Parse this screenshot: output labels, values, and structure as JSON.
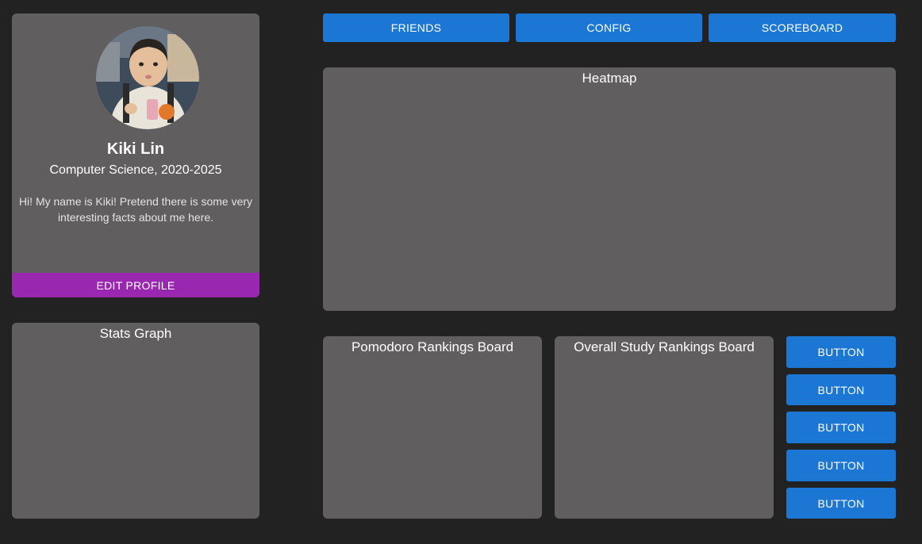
{
  "profile": {
    "name": "Kiki Lin",
    "major": "Computer Science, 2020-2025",
    "bio": "Hi! My name is Kiki! Pretend there is some very interesting facts about me here.",
    "edit_label": "EDIT PROFILE"
  },
  "nav": {
    "friends": "FRIENDS",
    "config": "CONFIG",
    "scoreboard": "SCOREBOARD"
  },
  "panels": {
    "heatmap": "Heatmap",
    "stats": "Stats Graph",
    "pomodoro": "Pomodoro Rankings Board",
    "overall": "Overall Study Rankings Board"
  },
  "side_buttons": [
    "BUTTON",
    "BUTTON",
    "BUTTON",
    "BUTTON",
    "BUTTON"
  ],
  "colors": {
    "background": "#222222",
    "panel": "#605e5f",
    "primary": "#1c76d3",
    "edit": "#9a27b0"
  }
}
